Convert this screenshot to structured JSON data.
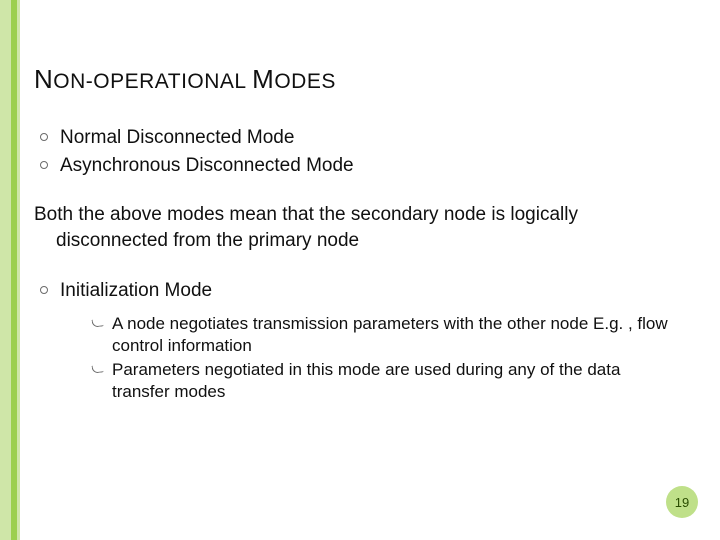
{
  "title": {
    "w1_cap": "N",
    "w1_rest": "ON",
    "hyphen": "-",
    "w2_rest": "OPERATIONAL",
    "space": " ",
    "w3_cap": "M",
    "w3_rest": "ODES"
  },
  "bullets_top": [
    "Normal Disconnected Mode",
    "Asynchronous Disconnected Mode"
  ],
  "paragraph": "Both the above modes mean that the secondary node is logically disconnected from the primary node",
  "bullets_bottom": [
    {
      "text": "Initialization Mode",
      "sub": [
        "A node negotiates transmission parameters with the other node E.g. , flow control information",
        "Parameters negotiated in this mode are used during any of the data transfer modes"
      ]
    }
  ],
  "page_number": "19"
}
